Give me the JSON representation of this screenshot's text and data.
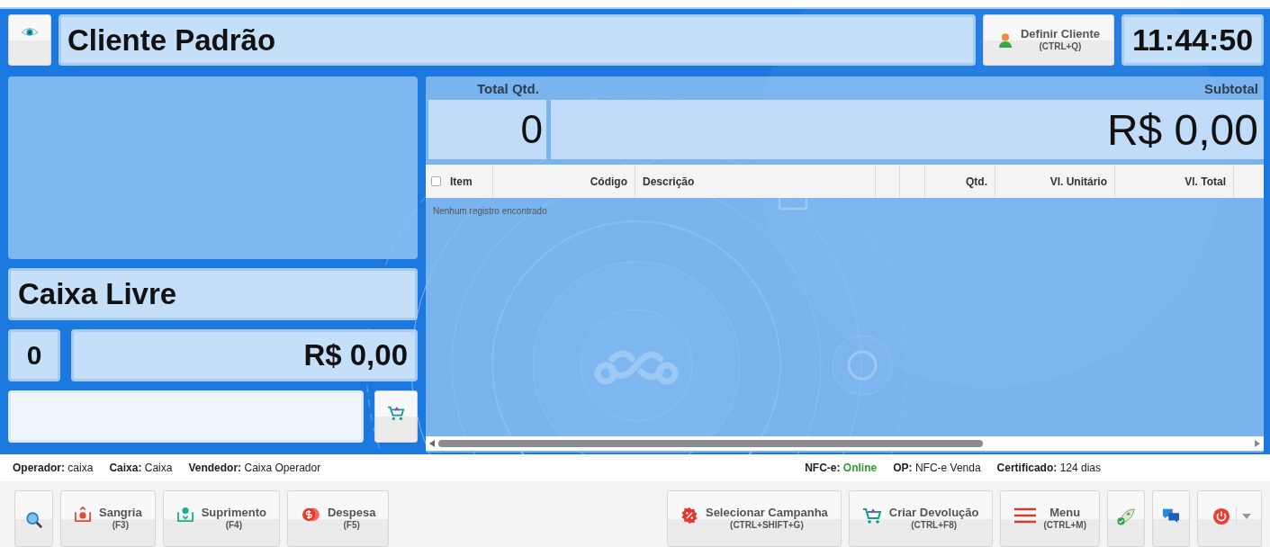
{
  "header": {
    "customer_name": "Cliente Padrão",
    "define_customer": {
      "label": "Definir Cliente",
      "shortcut": "(CTRL+Q)"
    },
    "clock": "11:44:50"
  },
  "left_panel": {
    "sale_status": "Caixa Livre",
    "item_count": "0",
    "item_total": "R$ 0,00"
  },
  "summary": {
    "qty_label": "Total Qtd.",
    "qty": "0",
    "subtotal_label": "Subtotal",
    "subtotal": "R$ 0,00"
  },
  "table": {
    "select_all_checked": false,
    "columns": [
      {
        "label": "Item",
        "kind": "label"
      },
      {
        "label": "Código",
        "kind": "label"
      },
      {
        "label": "Descrição",
        "kind": "label"
      },
      {
        "kind": "blank"
      },
      {
        "kind": "blank"
      },
      {
        "label": "Qtd.",
        "kind": "label"
      },
      {
        "label": "Vl. Unitário",
        "kind": "label"
      },
      {
        "label": "Vl. Total",
        "kind": "label"
      },
      {
        "kind": "blank"
      }
    ],
    "empty_message": "Nenhum registro encontrado"
  },
  "status_bar": {
    "left": [
      {
        "label": "Operador:",
        "value": "caixa"
      },
      {
        "label": "Caixa:",
        "value": "Caixa"
      },
      {
        "label": "Vendedor:",
        "value": "Caixa Operador"
      }
    ],
    "nfce": {
      "label": "NFC-e:",
      "value": "Online",
      "online": true
    },
    "right": [
      {
        "label": "OP:",
        "value": "NFC-e Venda"
      },
      {
        "label": "Certificado:",
        "value": "124 dias"
      }
    ]
  },
  "toolbar": {
    "left": [
      {
        "kind": "icon_button"
      },
      {
        "kind": "button",
        "label": "Sangria",
        "shortcut": "(F3)"
      },
      {
        "kind": "button",
        "label": "Suprimento",
        "shortcut": "(F4)"
      },
      {
        "kind": "button",
        "label": "Despesa",
        "shortcut": "(F5)"
      }
    ],
    "right": [
      {
        "kind": "button",
        "label": "Selecionar Campanha",
        "shortcut": "(CTRL+SHIFT+G)"
      },
      {
        "kind": "button",
        "label": "Criar Devolução",
        "shortcut": "(CTRL+F8)"
      },
      {
        "kind": "button",
        "label": "Menu",
        "shortcut": "(CTRL+M)"
      },
      {
        "kind": "icon_button"
      },
      {
        "kind": "icon_button"
      },
      {
        "kind": "icon_button"
      }
    ]
  }
}
